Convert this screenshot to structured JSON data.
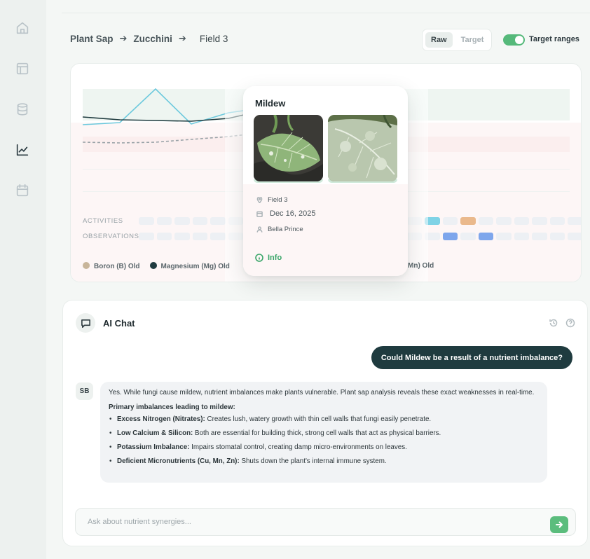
{
  "sidebar": {
    "items": [
      {
        "icon": "home-icon"
      },
      {
        "icon": "layout-icon"
      },
      {
        "icon": "database-icon"
      },
      {
        "icon": "chart-icon"
      },
      {
        "icon": "calendar-icon"
      }
    ],
    "active_index": 3
  },
  "breadcrumb": {
    "items": [
      "Plant Sap",
      "Zucchini",
      "Field 3"
    ],
    "separator": "➔"
  },
  "view_toggle": {
    "options": [
      "Raw",
      "Target"
    ],
    "selected": "Raw"
  },
  "target_ranges": {
    "label": "Target ranges",
    "enabled": true
  },
  "chart": {
    "row_labels": [
      "ACTIVITIES",
      "OBSERVATIONS"
    ],
    "legend": [
      {
        "name": "Boron (B) Old",
        "color": "#c8b59a"
      },
      {
        "name": "Magnesium (Mg) Old",
        "color": "#1f3b3f"
      }
    ],
    "legend_tail": "Mn) Old",
    "colors": {
      "series_cyan": "#6cc9dd",
      "series_dark": "#1f3b3f",
      "series_dashed": "#9aa3a8",
      "activity_cyan": "#7fd3e6",
      "activity_orange": "#eab98c",
      "observation_blue": "#7ea6ec"
    }
  },
  "popup": {
    "title": "Mildew",
    "location": "Field 3",
    "date": "Dec 16, 2025",
    "person": "Bella Prince",
    "info_label": "Info"
  },
  "chat": {
    "title": "AI Chat",
    "user_message": "Could Mildew be a result of a nutrient imbalance?",
    "avatar": "SB",
    "reply_intro": "Yes. While fungi cause mildew, nutrient imbalances make plants vulnerable. Plant sap analysis reveals these exact weaknesses in real-time.",
    "reply_heading": "Primary imbalances leading to mildew:",
    "reply_points": [
      {
        "title": "Excess Nitrogen (Nitrates):",
        "text": " Creates lush, watery growth with thin cell walls that fungi easily penetrate."
      },
      {
        "title": "Low Calcium & Silicon:",
        "text": " Both are essential for building thick, strong cell walls that act as physical barriers."
      },
      {
        "title": "Potassium Imbalance:",
        "text": " Impairs stomatal control, creating damp micro-environments on leaves."
      },
      {
        "title": "Deficient Micronutrients (Cu, Mn, Zn):",
        "text": " Shuts down the plant's internal immune system."
      }
    ],
    "input_placeholder": "Ask about nutrient synergies...",
    "brand_green": "#5bbd7d"
  }
}
